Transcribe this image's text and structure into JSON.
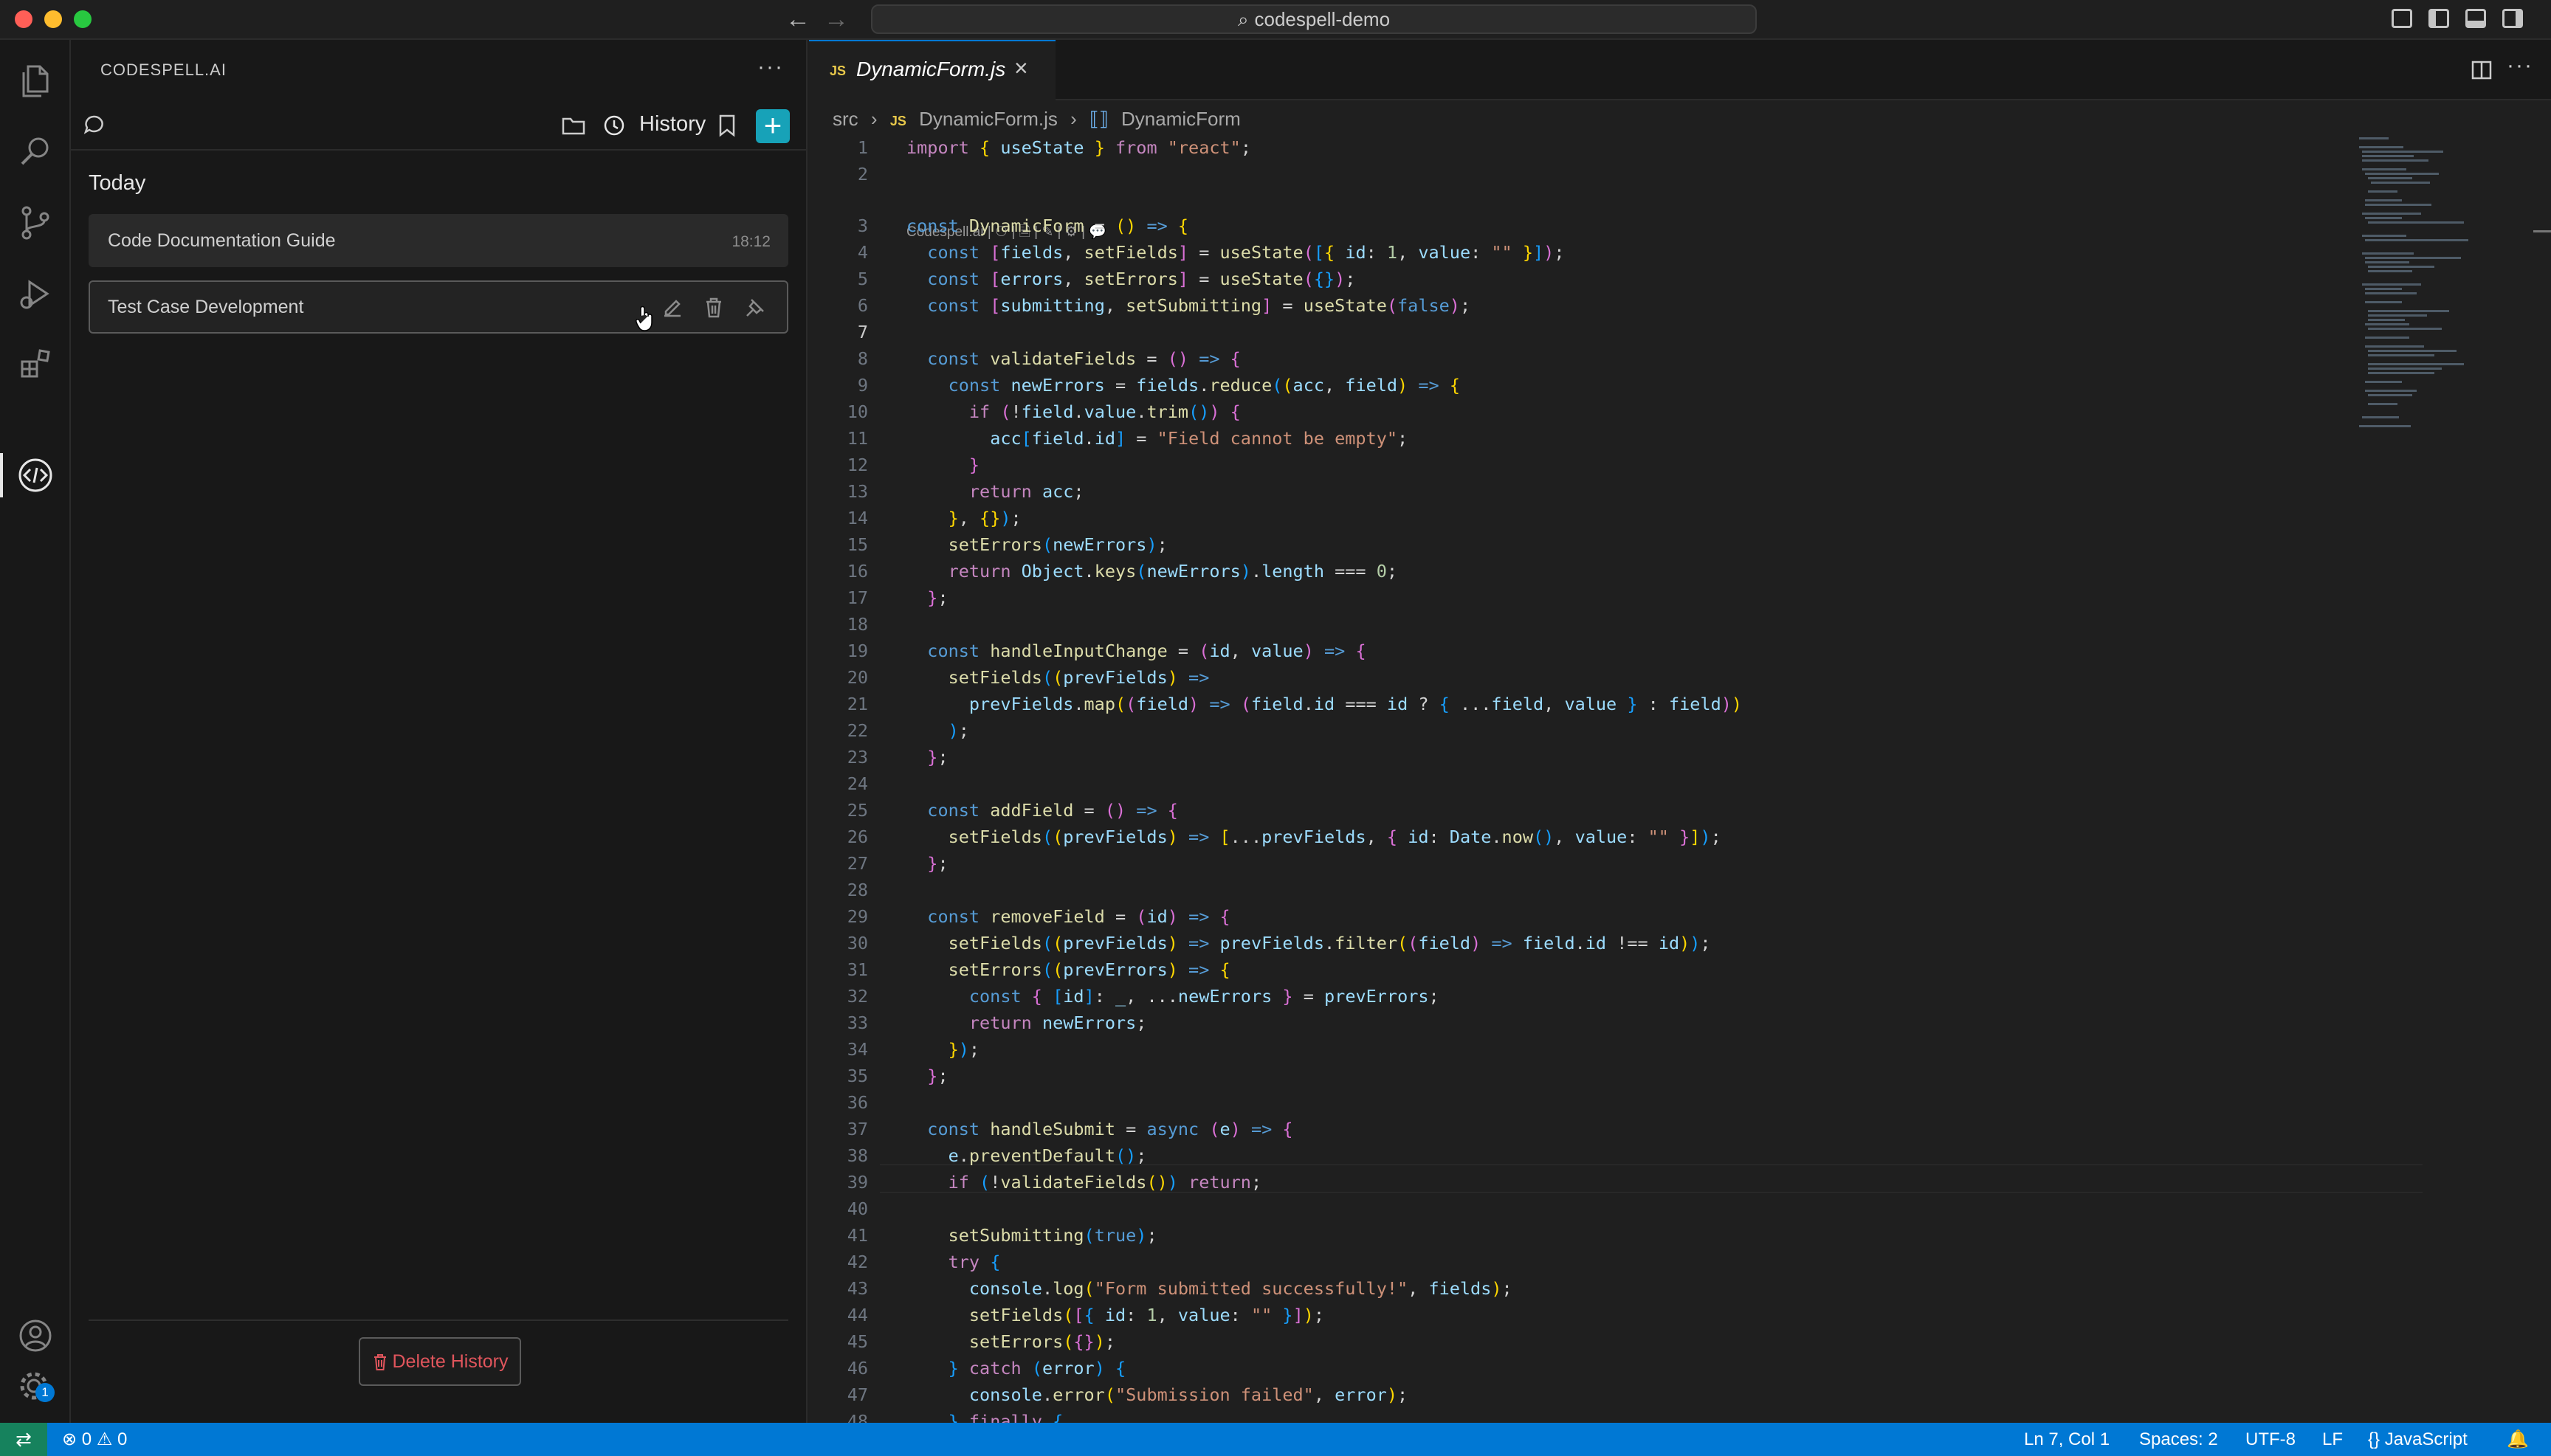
{
  "window": {
    "title": "codespell-demo"
  },
  "sidebar": {
    "title": "CODESPELL.AI",
    "toolbar": {
      "history_label": "History"
    },
    "section_label": "Today",
    "history": [
      {
        "title": "Code Documentation Guide",
        "time": "18:12"
      },
      {
        "title": "Test Case Development"
      }
    ],
    "delete_label": "Delete History",
    "settings_badge": "1"
  },
  "editor": {
    "tab": {
      "badge": "JS",
      "name": "DynamicForm.js"
    },
    "breadcrumb": {
      "folder": "src",
      "file": "DynamicForm.js",
      "symbol": "DynamicForm"
    },
    "codelens": "Codespell.ai | ⚇ | 🗎 | ✎ | ⚙ | 💬",
    "current_line": 7,
    "lines": [
      "1",
      "2",
      "3",
      "4",
      "5",
      "6",
      "7",
      "8",
      "9",
      "10",
      "11",
      "12",
      "13",
      "14",
      "15",
      "16",
      "17",
      "18",
      "19",
      "20",
      "21",
      "22",
      "23",
      "24",
      "25",
      "26",
      "27",
      "28",
      "29",
      "30",
      "31",
      "32",
      "33",
      "34",
      "35",
      "36",
      "37",
      "38",
      "39",
      "40",
      "41",
      "42",
      "43",
      "44",
      "45",
      "46",
      "47",
      "48"
    ]
  },
  "statusbar": {
    "errors": "0",
    "warnings": "0",
    "cursor": "Ln 7, Col 1",
    "spaces": "Spaces: 2",
    "encoding": "UTF-8",
    "eol": "LF",
    "language": "JavaScript"
  },
  "colors": {
    "accent": "#0078d4",
    "new_chat": "#17a2b8",
    "delete": "#e0555c"
  }
}
